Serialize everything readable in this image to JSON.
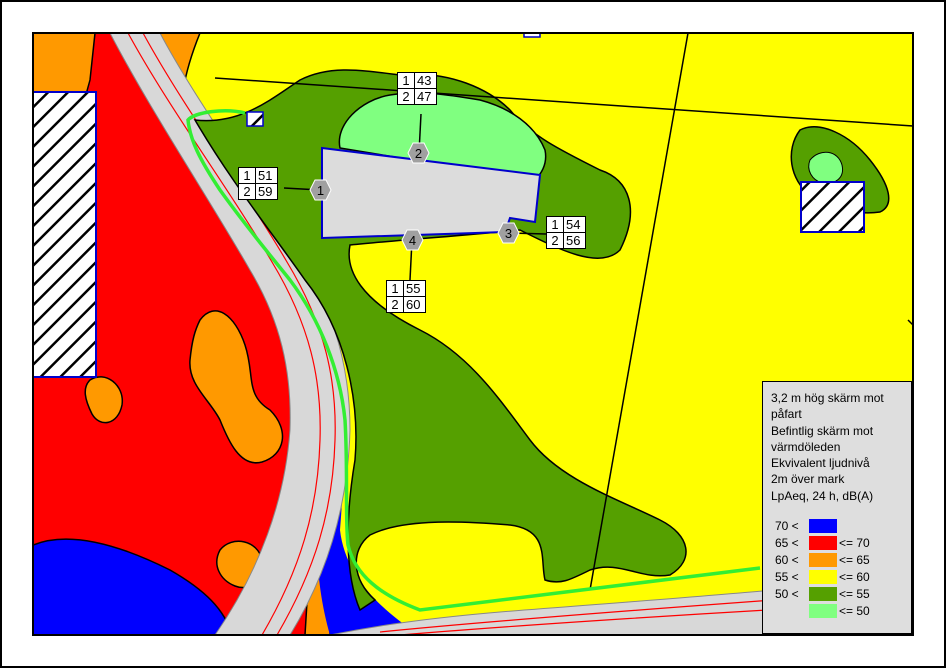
{
  "legend": {
    "title_lines": [
      "3,2 m hög skärm mot",
      "påfart",
      "Befintlig skärm mot",
      "värmdöleden",
      "Ekvivalent ljudnivå",
      "2m över mark",
      "LpAeq, 24 h, dB(A)"
    ],
    "rows": [
      {
        "lo": "70 <",
        "hi": "",
        "color": "#0000ff"
      },
      {
        "lo": "65 <",
        "hi": "<= 70",
        "color": "#ff0000"
      },
      {
        "lo": "60 <",
        "hi": "<= 65",
        "color": "#ff9900"
      },
      {
        "lo": "55 <",
        "hi": "<= 60",
        "color": "#ffff00"
      },
      {
        "lo": "50 <",
        "hi": "<= 55",
        "color": "#55a000"
      },
      {
        "lo": "",
        "hi": "<= 50",
        "color": "#80ff80"
      }
    ]
  },
  "points": [
    {
      "id": "1",
      "floors": [
        {
          "floor": "1",
          "level": "51"
        },
        {
          "floor": "2",
          "level": "59"
        }
      ]
    },
    {
      "id": "2",
      "floors": [
        {
          "floor": "1",
          "level": "43"
        },
        {
          "floor": "2",
          "level": "47"
        }
      ]
    },
    {
      "id": "3",
      "floors": [
        {
          "floor": "1",
          "level": "54"
        },
        {
          "floor": "2",
          "level": "56"
        }
      ]
    },
    {
      "id": "4",
      "floors": [
        {
          "floor": "1",
          "level": "55"
        },
        {
          "floor": "2",
          "level": "60"
        }
      ]
    }
  ],
  "colors": {
    "zone_over_70": "#0000ff",
    "zone_65_70": "#ff0000",
    "zone_60_65": "#ff9900",
    "zone_55_60": "#ffff00",
    "zone_50_55": "#55a000",
    "zone_under_50": "#80ff80",
    "building": "#dcdcdc",
    "screen": "#33ee33",
    "road": "#d8d8d8"
  }
}
